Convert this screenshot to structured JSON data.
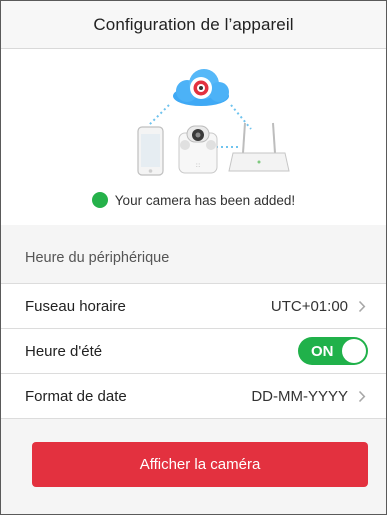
{
  "header": {
    "title": "Configuration de l’appareil"
  },
  "hero": {
    "illustration_icons": [
      "cloud-camera-icon",
      "phone-icon",
      "camera-device-icon",
      "router-icon"
    ],
    "success_icon": "check-circle-icon",
    "success_message": "Your camera has been added!"
  },
  "section": {
    "title": "Heure du périphérique"
  },
  "settings": {
    "timezone": {
      "label": "Fuseau horaire",
      "value": "UTC+01:00",
      "icon": "chevron-right-icon"
    },
    "dst": {
      "label": "Heure d'été",
      "toggle_text": "ON",
      "state": "on"
    },
    "date_format": {
      "label": "Format de date",
      "value": "DD-MM-YYYY",
      "icon": "chevron-right-icon"
    }
  },
  "actions": {
    "primary_label": "Afficher la caméra"
  },
  "colors": {
    "accent": "#e3313f",
    "toggle_on": "#20b14a",
    "success": "#25b14a"
  }
}
